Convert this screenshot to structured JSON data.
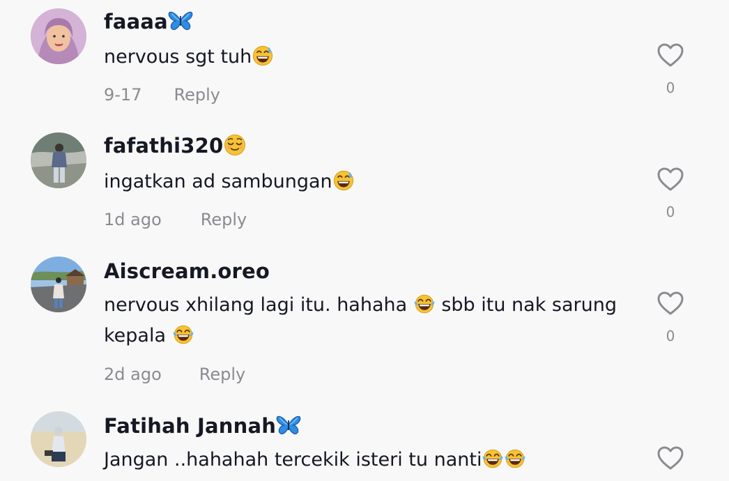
{
  "comments": [
    {
      "username": "faaaa",
      "username_emoji": "butterfly-emoji",
      "text": "nervous sgt tuh",
      "text_emoji": "grinning-sweat-emoji",
      "date": "9-17",
      "reply_label": "Reply",
      "likes": "0"
    },
    {
      "username": "fafathi320",
      "username_emoji": "relieved-face-emoji",
      "text": "ingatkan ad sambungan",
      "text_emoji": "grinning-sweat-emoji",
      "date": "1d ago",
      "reply_label": "Reply",
      "likes": "0"
    },
    {
      "username": "Aiscream.oreo",
      "text_part1": "nervous xhilang lagi itu. hahaha ",
      "text_part2": " sbb itu nak sarung",
      "text_part3": "kepala ",
      "text_emoji": "tears-of-joy-emoji",
      "date": "2d ago",
      "reply_label": "Reply",
      "likes": "0"
    },
    {
      "username": "Fatihah Jannah",
      "username_emoji": "butterfly-emoji",
      "text": "Jangan ..hahahah tercekik isteri tu nanti",
      "text_emoji": "tears-of-joy-emoji",
      "date": "",
      "reply_label": "",
      "likes": ""
    }
  ],
  "colors": {
    "primary_text": "#161823",
    "secondary_text": "#8a8b91",
    "background": "#f8f8f8",
    "heart_outline": "#8a8b91"
  }
}
